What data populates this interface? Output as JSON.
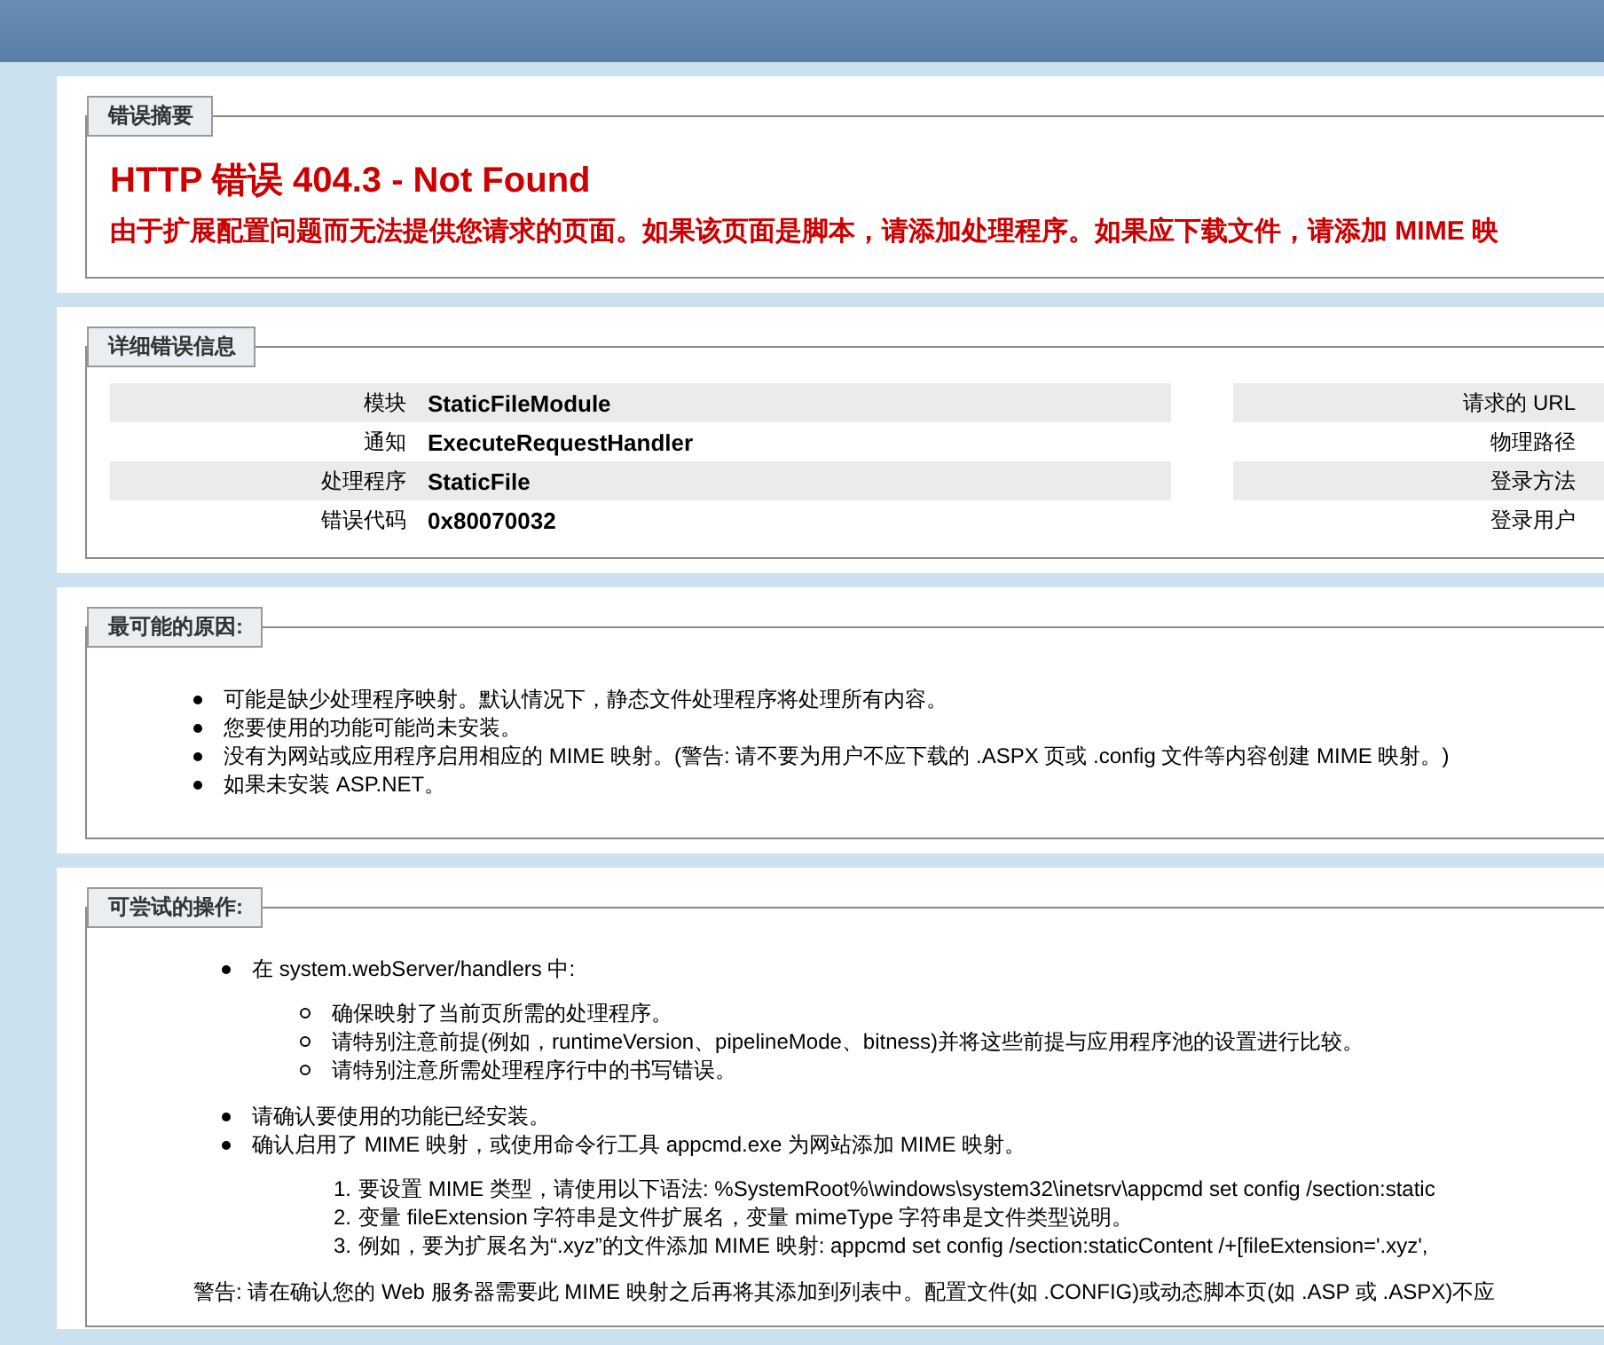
{
  "summary": {
    "legend": "错误摘要",
    "title": "HTTP 错误 404.3 - Not Found",
    "message": "由于扩展配置问题而无法提供您请求的页面。如果该页面是脚本，请添加处理程序。如果应下载文件，请添加 MIME 映"
  },
  "details": {
    "legend": "详细错误信息",
    "left_rows": [
      {
        "label": "模块",
        "value": "StaticFileModule"
      },
      {
        "label": "通知",
        "value": "ExecuteRequestHandler"
      },
      {
        "label": "处理程序",
        "value": "StaticFile"
      },
      {
        "label": "错误代码",
        "value": "0x80070032"
      }
    ],
    "right_rows": [
      {
        "label": "请求的 URL"
      },
      {
        "label": "物理路径"
      },
      {
        "label": "登录方法"
      },
      {
        "label": "登录用户"
      }
    ]
  },
  "causes": {
    "legend": "最可能的原因:",
    "items": [
      "可能是缺少处理程序映射。默认情况下，静态文件处理程序将处理所有内容。",
      "您要使用的功能可能尚未安装。",
      "没有为网站或应用程序启用相应的 MIME 映射。(警告: 请不要为用户不应下载的 .ASPX 页或 .config 文件等内容创建 MIME 映射。)",
      "如果未安装 ASP.NET。"
    ]
  },
  "actions": {
    "legend": "可尝试的操作:",
    "items": [
      {
        "text": "在 system.webServer/handlers 中:",
        "children": [
          "确保映射了当前页所需的处理程序。",
          "请特别注意前提(例如，runtimeVersion、pipelineMode、bitness)并将这些前提与应用程序池的设置进行比较。",
          "请特别注意所需处理程序行中的书写错误。"
        ]
      },
      {
        "text": "请确认要使用的功能已经安装。"
      },
      {
        "text": "确认启用了 MIME 映射，或使用命令行工具 appcmd.exe 为网站添加 MIME 映射。",
        "steps": [
          {
            "number": "1.",
            "text": "要设置 MIME 类型，请使用以下语法: %SystemRoot%\\windows\\system32\\inetsrv\\appcmd set config /section:static"
          },
          {
            "number": "2.",
            "text": "变量 fileExtension 字符串是文件扩展名，变量 mimeType 字符串是文件类型说明。"
          },
          {
            "number": "3.",
            "text": "例如，要为扩展名为“.xyz”的文件添加 MIME 映射: appcmd set config /section:staticContent /+[fileExtension='.xyz',"
          }
        ]
      }
    ],
    "warning": "警告: 请在确认您的 Web 服务器需要此 MIME 映射之后再将其添加到列表中。配置文件(如 .CONFIG)或动态脚本页(如 .ASP 或 .ASPX)不应"
  }
}
